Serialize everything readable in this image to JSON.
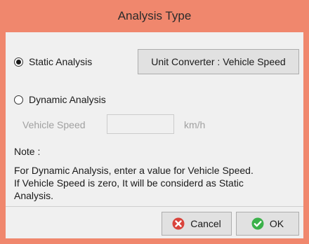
{
  "window": {
    "title": "Analysis Type"
  },
  "analysis": {
    "static_label": "Static Analysis",
    "static_selected": true,
    "dynamic_label": "Dynamic Analysis",
    "dynamic_selected": false
  },
  "unit_converter": {
    "label": "Unit Converter : Vehicle Speed"
  },
  "vehicle_speed": {
    "label": "Vehicle Speed",
    "value": "",
    "unit": "km/h"
  },
  "note": {
    "title": "Note :",
    "line1": "For Dynamic Analysis, enter a value for Vehicle Speed.",
    "line2": "If Vehicle Speed is zero, It will be considerd as Static",
    "line3": "Analysis."
  },
  "buttons": {
    "cancel_label": "Cancel",
    "ok_label": "OK"
  },
  "icons": {
    "cancel": "cancel-icon",
    "ok": "ok-check-icon"
  },
  "colors": {
    "titlebar": "#f0876d",
    "cancel_icon": "#d9433b",
    "ok_icon": "#3bb14a"
  }
}
